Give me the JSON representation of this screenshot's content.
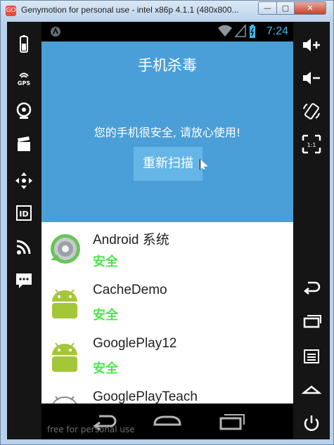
{
  "window": {
    "title": "Genymotion for personal use - intel x86p 4.1.1 (480x800...",
    "app_icon_text": "GO",
    "minimize_label": "—",
    "maximize_label": "▢",
    "close_label": "✕"
  },
  "left_sidebar": [
    {
      "name": "battery-icon",
      "glyph": "▮"
    },
    {
      "name": "gps-icon",
      "glyph": "GPS"
    },
    {
      "name": "webcam-icon",
      "glyph": "◉"
    },
    {
      "name": "clapper-icon",
      "glyph": "▤"
    },
    {
      "name": "move-icon",
      "glyph": "✥"
    },
    {
      "name": "id-icon",
      "glyph": "ID"
    },
    {
      "name": "rss-icon",
      "glyph": "◣"
    },
    {
      "name": "sms-icon",
      "glyph": "…"
    }
  ],
  "right_sidebar": [
    {
      "name": "volume-up-icon",
      "glyph": "◀+"
    },
    {
      "name": "volume-down-icon",
      "glyph": "◀−"
    },
    {
      "name": "rotate-icon",
      "glyph": "⟳"
    },
    {
      "name": "scale-icon",
      "glyph": "1:1"
    },
    {
      "name": "back-icon",
      "glyph": "↩"
    },
    {
      "name": "recents-icon",
      "glyph": "▭"
    },
    {
      "name": "menu-icon",
      "glyph": "≡"
    },
    {
      "name": "home-icon",
      "glyph": "⌂"
    },
    {
      "name": "power-icon",
      "glyph": "⏻"
    }
  ],
  "status_bar": {
    "time": "7:24",
    "wifi_icon": "wifi-icon",
    "battery_icon": "battery-icon"
  },
  "header": {
    "title": "手机杀毒",
    "status_text": "您的手机很安全, 请放心使用!",
    "rescan_button": "重新扫描"
  },
  "apps": [
    {
      "name": "Android 系统",
      "state": "安全",
      "icon": "android-system-icon"
    },
    {
      "name": "CacheDemo",
      "state": "安全",
      "icon": "android-robot-icon"
    },
    {
      "name": "GooglePlay12",
      "state": "安全",
      "icon": "android-robot-icon"
    },
    {
      "name": "GooglePlayTeach",
      "state": "",
      "icon": "android-robot-icon"
    }
  ],
  "navbar": {
    "watermark": "free for personal use"
  },
  "colors": {
    "header_blue": "#4a9fd8",
    "button_blue": "#65b6e7",
    "safe_green": "#4ee44b",
    "time_blue": "#3eb7e9"
  }
}
